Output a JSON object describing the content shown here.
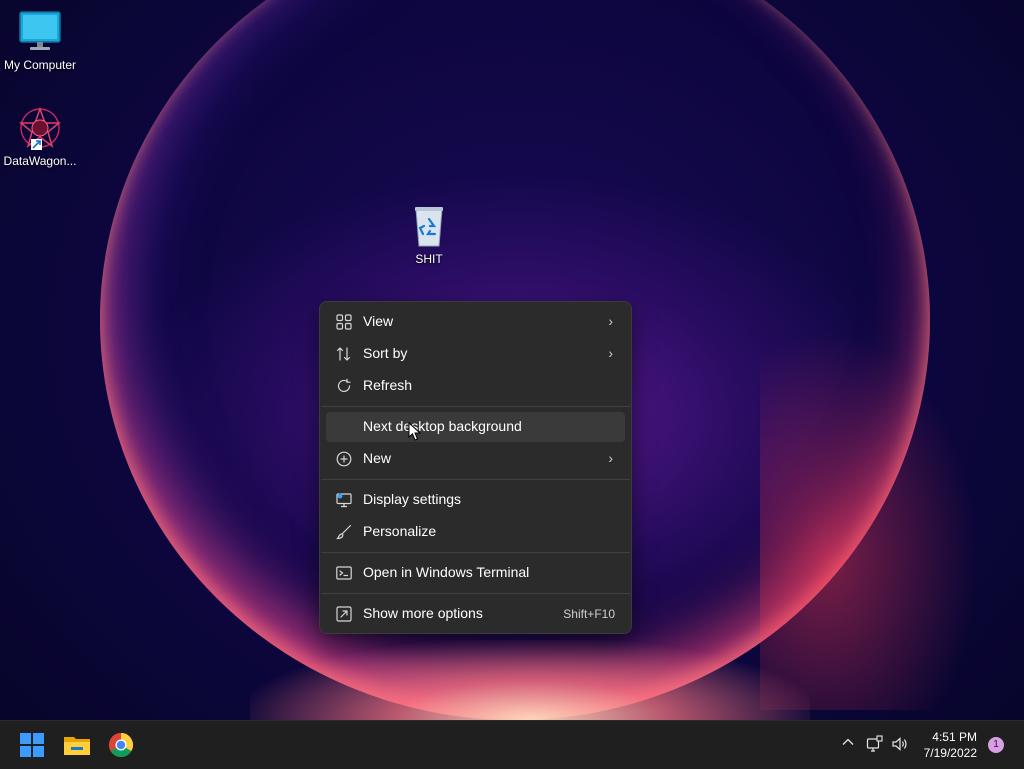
{
  "desktop": {
    "icons": [
      {
        "label": "My Computer",
        "icon": "monitor-icon"
      },
      {
        "label": "DataWagon...",
        "icon": "datawagon-shortcut-icon"
      },
      {
        "label": "SHIT",
        "icon": "recycle-bin-icon"
      }
    ]
  },
  "context_menu": {
    "items": [
      {
        "label": "View",
        "icon": "grid-icon",
        "submenu": true
      },
      {
        "label": "Sort by",
        "icon": "sort-icon",
        "submenu": true
      },
      {
        "label": "Refresh",
        "icon": "refresh-icon"
      },
      {
        "label": "Next desktop background",
        "icon": "",
        "highlighted": true
      },
      {
        "label": "New",
        "icon": "plus-circle-icon",
        "submenu": true
      },
      {
        "label": "Display settings",
        "icon": "display-icon"
      },
      {
        "label": "Personalize",
        "icon": "brush-icon"
      },
      {
        "label": "Open in Windows Terminal",
        "icon": "terminal-icon"
      },
      {
        "label": "Show more options",
        "icon": "expand-icon",
        "accelerator": "Shift+F10"
      }
    ],
    "submenu_arrow": "›"
  },
  "taskbar": {
    "apps": [
      "start-icon",
      "file-explorer-icon",
      "chrome-icon"
    ],
    "tray": {
      "chevron": "^",
      "time": "4:51 PM",
      "date": "7/19/2022",
      "notification_count": "1"
    }
  },
  "colors": {
    "menu_bg": "#2b2b2b",
    "menu_hover": "#3a3a3a",
    "taskbar_bg": "#1f1f1f",
    "start_blue": "#3b9bff"
  }
}
